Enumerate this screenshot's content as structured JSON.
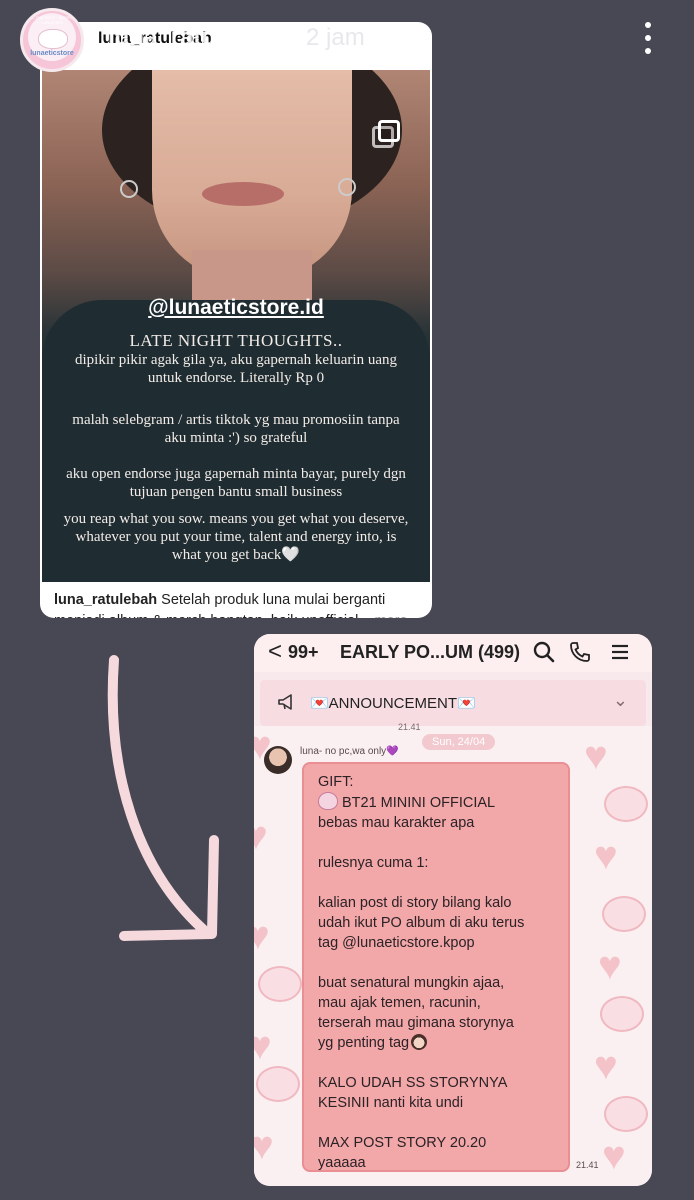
{
  "story": {
    "username": "luna_ratulebah",
    "time": "2 jam"
  },
  "post": {
    "username": "luna_ratulebah",
    "mention": "@lunaeticstore.id",
    "lines": {
      "title": "LATE NIGHT THOUGHTS..",
      "p1": "dipikir pikir agak gila ya, aku gapernah keluarin uang untuk endorse. Literally Rp 0",
      "p2": "malah selebgram / artis tiktok yg mau promosiin tanpa aku minta :') so grateful",
      "p3": "aku open endorse juga gapernah minta bayar, purely dgn tujuan pengen bantu small business",
      "p4": "you reap what you sow. means you get what you deserve, whatever you put your time, talent and energy into, is what you get back🤍"
    },
    "caption_user": "luna_ratulebah",
    "caption_text": "Setelah produk luna mulai berganti menjadi album & merch bangtan, baik unofficial...",
    "caption_more": "more"
  },
  "chat": {
    "back": "<",
    "count": "99+",
    "title": "EARLY PO...UM (499)",
    "announcement": "💌ANNOUNCEMENT💌",
    "time_top": "21.41",
    "date_chip": "Sun, 24/04",
    "sender": "luna- no pc,wa only",
    "messages": [
      "GIFT:",
      "BT21 MININI OFFICIAL",
      "bebas mau karakter apa",
      "",
      "rulesnya cuma 1:",
      "",
      "kalian post di story bilang kalo",
      "udah ikut PO album di aku terus",
      "tag @lunaeticstore.kpop",
      "",
      "buat senatural mungkin ajaa,",
      "mau ajak temen, racunin,",
      "terserah mau gimana storynya",
      "yg penting tag",
      "",
      "KALO UDAH SS STORYNYA",
      "KESINII nanti kita undi",
      "",
      "MAX POST STORY 20.20",
      "yaaaaa"
    ],
    "msg_time": "21.41"
  },
  "icons": {
    "more": "more-vertical-icon",
    "multi": "multiple-photos-icon",
    "search": "search-icon",
    "call": "phone-icon",
    "menu": "menu-icon",
    "announce": "megaphone-icon",
    "chevron": "chevron-down-icon"
  },
  "colors": {
    "background": "#474853",
    "bubble": "#f2a7a9",
    "chat_bg": "#fbf0f1",
    "arrow": "#f6d9dd"
  }
}
